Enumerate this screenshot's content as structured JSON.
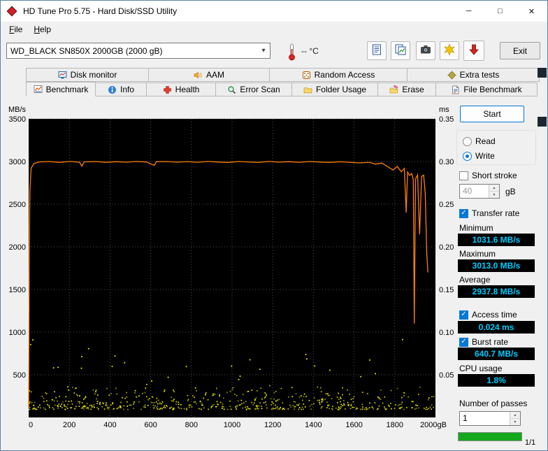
{
  "window": {
    "title": "HD Tune Pro 5.75 - Hard Disk/SSD Utility"
  },
  "icons": {
    "minimize": "─",
    "maximize": "□",
    "close": "✕",
    "combo_arrow": "▾",
    "check": "✓",
    "spinner_up": "▲",
    "spinner_down": "▼"
  },
  "menu": {
    "items": [
      {
        "label": "File"
      },
      {
        "label": "Help"
      }
    ]
  },
  "toolbar": {
    "drive_selector": "WD_BLACK SN850X 2000GB (2000 gB)",
    "temperature": "-- °C",
    "exit_label": "Exit"
  },
  "tabs": {
    "active": "Benchmark",
    "row1": [
      {
        "label": "Disk monitor"
      },
      {
        "label": "AAM"
      },
      {
        "label": "Random Access"
      },
      {
        "label": "Extra tests"
      }
    ],
    "row2": [
      {
        "label": "Benchmark"
      },
      {
        "label": "Info"
      },
      {
        "label": "Health"
      },
      {
        "label": "Error Scan"
      },
      {
        "label": "Folder Usage"
      },
      {
        "label": "Erase"
      },
      {
        "label": "File Benchmark"
      }
    ]
  },
  "panel": {
    "start_label": "Start",
    "read_label": "Read",
    "write_label": "Write",
    "read_selected": false,
    "write_selected": true,
    "short_stroke": {
      "label": "Short stroke",
      "checked": false,
      "value": "40",
      "unit": "gB"
    },
    "transfer_rate": {
      "label": "Transfer rate",
      "checked": true
    },
    "minimum": {
      "label": "Minimum",
      "value": "1031.6 MB/s"
    },
    "maximum": {
      "label": "Maximum",
      "value": "3013.0 MB/s"
    },
    "average": {
      "label": "Average",
      "value": "2937.8 MB/s"
    },
    "access_time": {
      "label": "Access time",
      "checked": true,
      "value": "0.024 ms"
    },
    "burst_rate": {
      "label": "Burst rate",
      "checked": true,
      "value": "640.7 MB/s"
    },
    "cpu_usage": {
      "label": "CPU usage",
      "value": "1.8%"
    },
    "passes": {
      "label": "Number of passes",
      "value": "1"
    },
    "progress": {
      "percent": 100,
      "label": "1/1"
    }
  },
  "chart_data": {
    "type": "line",
    "title": "",
    "x_axis": {
      "min": 0,
      "max": 2000,
      "ticks": [
        0,
        200,
        400,
        600,
        800,
        1000,
        1200,
        1400,
        1600,
        1800
      ],
      "last_tick_label": "2000gB"
    },
    "y_left": {
      "unit": "MB/s",
      "min": 0,
      "max": 3500,
      "ticks": [
        3500,
        3000,
        2500,
        2000,
        1500,
        1000,
        500
      ]
    },
    "y_right": {
      "unit": "ms",
      "min": 0,
      "max": 0.35,
      "ticks": [
        "0.35",
        "0.30",
        "0.25",
        "0.20",
        "0.15",
        "0.10",
        "0.05"
      ]
    },
    "colors": {
      "plot_bg": "#000000",
      "grid": "#4d4d4d",
      "transfer": "#ff8000",
      "access": "#ffff00"
    },
    "legend": "off",
    "transfer_rate_line": {
      "name": "Transfer rate (MB/s) vs position (gB)",
      "points": [
        [
          0,
          120
        ],
        [
          3,
          1750
        ],
        [
          6,
          2650
        ],
        [
          12,
          2920
        ],
        [
          25,
          2975
        ],
        [
          50,
          2995
        ],
        [
          100,
          3000
        ],
        [
          150,
          2990
        ],
        [
          205,
          3001
        ],
        [
          250,
          2992
        ],
        [
          262,
          2945
        ],
        [
          272,
          2996
        ],
        [
          330,
          3000
        ],
        [
          380,
          2990
        ],
        [
          430,
          2998
        ],
        [
          480,
          2992
        ],
        [
          530,
          3001
        ],
        [
          580,
          2994
        ],
        [
          618,
          2955
        ],
        [
          628,
          2998
        ],
        [
          680,
          3000
        ],
        [
          730,
          2993
        ],
        [
          780,
          2999
        ],
        [
          830,
          2991
        ],
        [
          880,
          3001
        ],
        [
          930,
          2994
        ],
        [
          980,
          2989
        ],
        [
          1030,
          3000
        ],
        [
          1080,
          2995
        ],
        [
          1130,
          2990
        ],
        [
          1180,
          3001
        ],
        [
          1230,
          2993
        ],
        [
          1280,
          2998
        ],
        [
          1330,
          2991
        ],
        [
          1380,
          3000
        ],
        [
          1430,
          2994
        ],
        [
          1480,
          2990
        ],
        [
          1530,
          2997
        ],
        [
          1580,
          2991
        ],
        [
          1625,
          2984
        ],
        [
          1675,
          2991
        ],
        [
          1705,
          2970
        ],
        [
          1735,
          2983
        ],
        [
          1765,
          2940
        ],
        [
          1792,
          2900
        ],
        [
          1812,
          2943
        ],
        [
          1832,
          2880
        ],
        [
          1847,
          2920
        ],
        [
          1856,
          2400
        ],
        [
          1863,
          2876
        ],
        [
          1873,
          2836
        ],
        [
          1883,
          2860
        ],
        [
          1891,
          2786
        ],
        [
          1896,
          1100
        ],
        [
          1902,
          2796
        ],
        [
          1912,
          2842
        ],
        [
          1922,
          2146
        ],
        [
          1932,
          2826
        ],
        [
          1942,
          2840
        ],
        [
          1950,
          2620
        ],
        [
          1957,
          1930
        ],
        [
          1963,
          1700
        ]
      ]
    },
    "access_time_scatter": {
      "name": "Access time (ms)",
      "band_y_ms": [
        0.01,
        0.04
      ],
      "outliers_y_ms_max": 0.095,
      "count": 560,
      "outlier_count": 26,
      "seed": 7
    }
  }
}
